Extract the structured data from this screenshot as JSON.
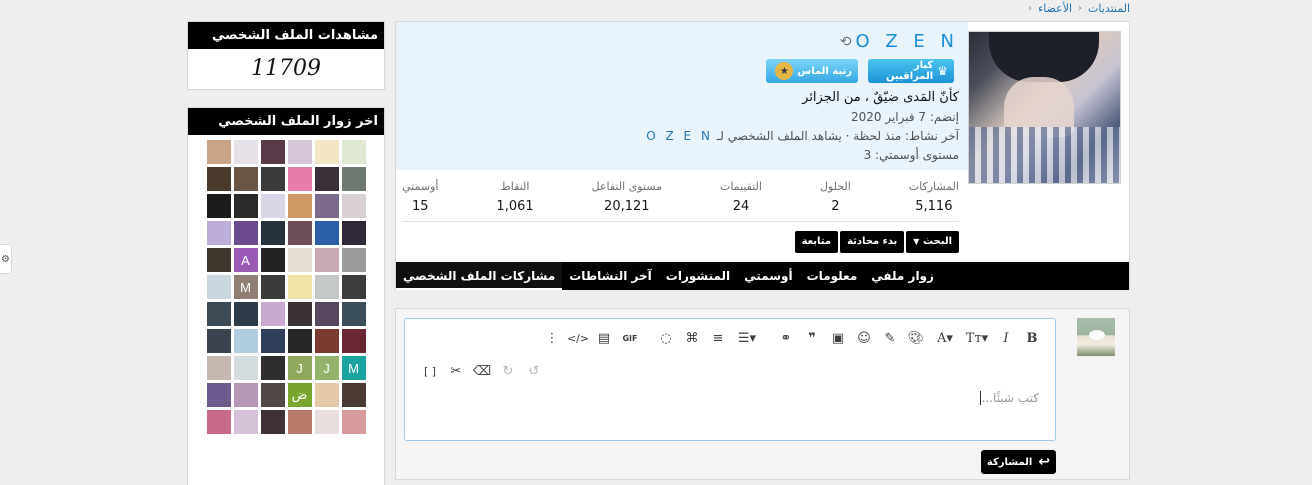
{
  "breadcrumb": {
    "items": [
      "المنتديات",
      "الأعضاء"
    ]
  },
  "views": {
    "title": "مشاهدات الملف الشخصي",
    "count": "11709"
  },
  "visitors": {
    "title": "اخر زوار الملف الشخصي",
    "avatars": [
      {
        "c": "#dfe8d0",
        "t": ""
      },
      {
        "c": "#f2e6c4",
        "t": ""
      },
      {
        "c": "#d7c6d9",
        "t": ""
      },
      {
        "c": "#5b3a4a",
        "t": ""
      },
      {
        "c": "#e6e0e8",
        "t": ""
      },
      {
        "c": "#c9a486",
        "t": ""
      },
      {
        "c": "#6e7a70",
        "t": ""
      },
      {
        "c": "#3b2f3a",
        "t": ""
      },
      {
        "c": "#e67aa9",
        "t": ""
      },
      {
        "c": "#3a3a3a",
        "t": ""
      },
      {
        "c": "#6b5545",
        "t": ""
      },
      {
        "c": "#4a3a2c",
        "t": ""
      },
      {
        "c": "#d9d0d6",
        "t": ""
      },
      {
        "c": "#7b6a8c",
        "t": ""
      },
      {
        "c": "#cf9a66",
        "t": ""
      },
      {
        "c": "#d6d6e6",
        "t": ""
      },
      {
        "c": "#2a2a2a",
        "t": ""
      },
      {
        "c": "#1b1b1b",
        "t": ""
      },
      {
        "c": "#2e2838",
        "t": ""
      },
      {
        "c": "#2b5fa8",
        "t": ""
      },
      {
        "c": "#6c4c57",
        "t": ""
      },
      {
        "c": "#28323e",
        "t": ""
      },
      {
        "c": "#6c4a8e",
        "t": ""
      },
      {
        "c": "#bdaed8",
        "t": ""
      },
      {
        "c": "#9a9a9a",
        "t": ""
      },
      {
        "c": "#c8a8b4",
        "t": ""
      },
      {
        "c": "#e6ded0",
        "t": ""
      },
      {
        "c": "#222222",
        "t": ""
      },
      {
        "c": "#9b59b6",
        "t": "A"
      },
      {
        "c": "#40382f",
        "t": ""
      },
      {
        "c": "#3c3c3c",
        "t": ""
      },
      {
        "c": "#c4c8c6",
        "t": ""
      },
      {
        "c": "#efe4a6",
        "t": ""
      },
      {
        "c": "#3a3a3a",
        "t": ""
      },
      {
        "c": "#8e7e74",
        "t": "M"
      },
      {
        "c": "#c9d8de",
        "t": ""
      },
      {
        "c": "#3a4e5a",
        "t": ""
      },
      {
        "c": "#56465e",
        "t": ""
      },
      {
        "c": "#3a3232",
        "t": ""
      },
      {
        "c": "#caa9d0",
        "t": ""
      },
      {
        "c": "#2e3c4a",
        "t": ""
      },
      {
        "c": "#3c4a55",
        "t": ""
      },
      {
        "c": "#6b2633",
        "t": ""
      },
      {
        "c": "#7a3a2e",
        "t": ""
      },
      {
        "c": "#262626",
        "t": ""
      },
      {
        "c": "#2f3e5a",
        "t": ""
      },
      {
        "c": "#b0cde0",
        "t": ""
      },
      {
        "c": "#3b4350",
        "t": ""
      },
      {
        "c": "#1aa3a0",
        "t": "M"
      },
      {
        "c": "#93b56b",
        "t": "J"
      },
      {
        "c": "#8fa85c",
        "t": "J"
      },
      {
        "c": "#2e2e2e",
        "t": ""
      },
      {
        "c": "#d5dcdf",
        "t": ""
      },
      {
        "c": "#c6b8b0",
        "t": ""
      },
      {
        "c": "#4a3a33",
        "t": ""
      },
      {
        "c": "#e4c8a8",
        "t": ""
      },
      {
        "c": "#78a52e",
        "t": "ض"
      },
      {
        "c": "#524846",
        "t": ""
      },
      {
        "c": "#b698b6",
        "t": ""
      },
      {
        "c": "#6c5a8e",
        "t": ""
      },
      {
        "c": "#d89b9b",
        "t": ""
      },
      {
        "c": "#e9dede",
        "t": ""
      },
      {
        "c": "#b97a6a",
        "t": ""
      },
      {
        "c": "#3e3238",
        "t": ""
      },
      {
        "c": "#d5c2d8",
        "t": ""
      },
      {
        "c": "#c86a8a",
        "t": ""
      }
    ]
  },
  "profile": {
    "username": "O Z E N",
    "banner_1": "كبار المراقبين",
    "banner_2": "رتبة الماس",
    "custom_title": "كأنّ المَدى ضيّقٌ ، من الجزائر",
    "joined": "إنضم: 7 فبراير 2020",
    "last_seen_prefix": "آخر نشاط: منذ لحظة · يشاهد الملف الشخصي لـ",
    "last_seen_user": "O Z E N",
    "level": "مستوى أوسمتي: 3",
    "stats": [
      {
        "label": "المشاركات",
        "value": "5,116"
      },
      {
        "label": "الحلول",
        "value": "2"
      },
      {
        "label": "التقييمات",
        "value": "24"
      },
      {
        "label": "مستوى التفاعل",
        "value": "20,121"
      },
      {
        "label": "النقاط",
        "value": "1,061"
      },
      {
        "label": "أوسمتي",
        "value": "15"
      }
    ],
    "actions": {
      "follow": "متابعة",
      "start_conversation": "بدء محادثة",
      "search": "البحث"
    },
    "tabs": [
      "مشاركات الملف الشخصي",
      "آخر النشاطات",
      "المنشورات",
      "أوسمتي",
      "معلومات",
      "زوار ملفي"
    ]
  },
  "composer": {
    "placeholder": "كتب شيئًا...",
    "post_button": "المشاركة"
  },
  "edge_widget": {
    "glyph": "⚙"
  }
}
